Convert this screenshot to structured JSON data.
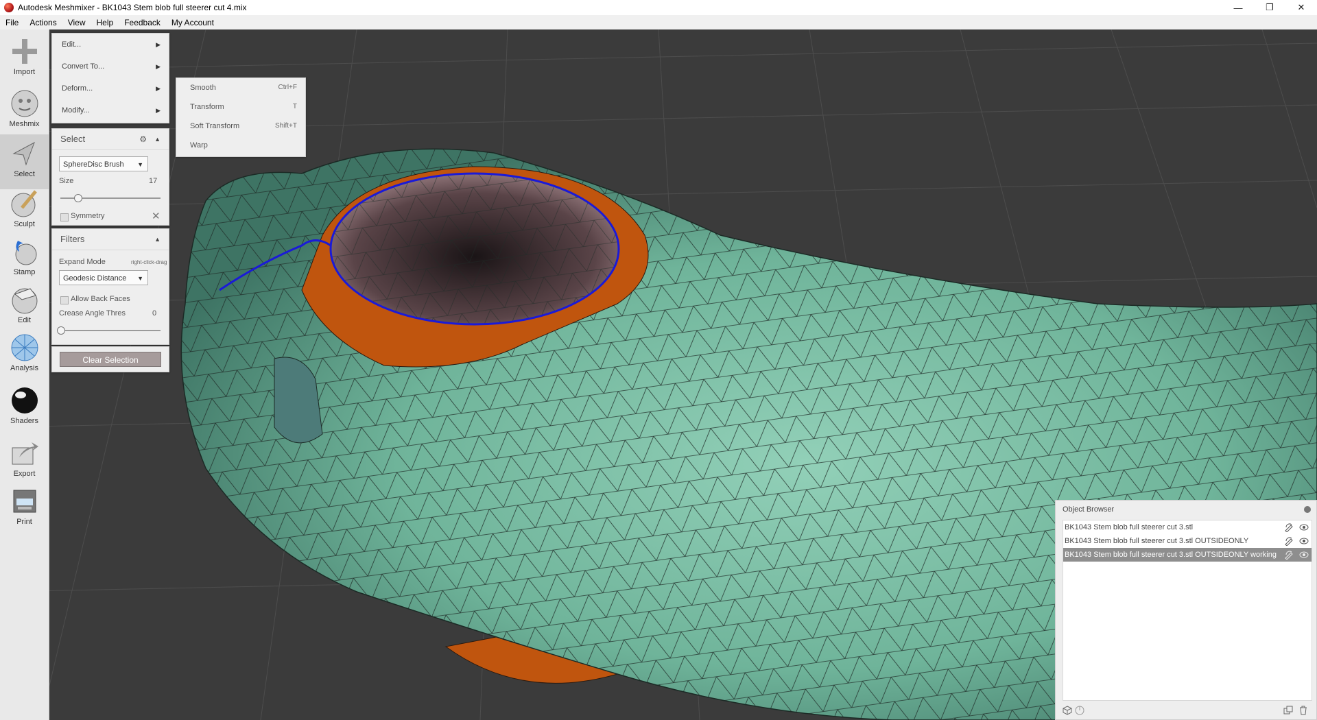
{
  "window": {
    "title": "Autodesk Meshmixer - BK1043 Stem blob full steerer cut 4.mix",
    "minimize": "—",
    "restore": "❐",
    "close": "✕"
  },
  "menubar": {
    "items": [
      "File",
      "Actions",
      "View",
      "Help",
      "Feedback",
      "My Account"
    ]
  },
  "toolbar": {
    "tools": [
      {
        "label": "Import",
        "icon": "plus-icon"
      },
      {
        "label": "Meshmix",
        "icon": "meshmix-sphere-icon"
      },
      {
        "label": "Select",
        "icon": "arrow-cursor-icon"
      },
      {
        "label": "Sculpt",
        "icon": "brush-sphere-icon"
      },
      {
        "label": "Stamp",
        "icon": "stamp-icon"
      },
      {
        "label": "Edit",
        "icon": "edit-sphere-icon"
      },
      {
        "label": "Analysis",
        "icon": "analysis-sphere-icon"
      },
      {
        "label": "Shaders",
        "icon": "shader-ball-icon"
      },
      {
        "label": "Export",
        "icon": "export-icon"
      },
      {
        "label": "Print",
        "icon": "printer-icon"
      }
    ]
  },
  "actions_menu": {
    "items": [
      {
        "label": "Edit..."
      },
      {
        "label": "Convert To..."
      },
      {
        "label": "Deform..."
      },
      {
        "label": "Modify..."
      }
    ]
  },
  "deform_submenu": {
    "items": [
      {
        "label": "Smooth",
        "shortcut": "Ctrl+F"
      },
      {
        "label": "Transform",
        "shortcut": "T"
      },
      {
        "label": "Soft Transform",
        "shortcut": "Shift+T"
      },
      {
        "label": "Warp",
        "shortcut": ""
      }
    ]
  },
  "select_panel": {
    "title": "Select",
    "brush": "SphereDisc Brush",
    "size_label": "Size",
    "size_value": "17",
    "size_fraction": 0.17,
    "symmetry_label": "Symmetry"
  },
  "filters_panel": {
    "title": "Filters",
    "expand_mode_label": "Expand Mode",
    "expand_hint": "right-click-drag",
    "expand_mode_value": "Geodesic Distance",
    "back_faces_label": "Allow Back Faces",
    "crease_label": "Crease Angle Thres",
    "crease_value": "0",
    "crease_fraction": 0.0
  },
  "clear_selection": "Clear Selection",
  "object_browser": {
    "title": "Object Browser",
    "objects": [
      {
        "name": "BK1043 Stem blob full steerer cut 3.stl",
        "selected": false
      },
      {
        "name": "BK1043 Stem blob full steerer cut 3.stl OUTSIDEONLY",
        "selected": false
      },
      {
        "name": "BK1043 Stem blob full steerer cut 3.stl OUTSIDEONLY working",
        "selected": true
      }
    ]
  },
  "colors": {
    "mesh_green": "#6fb49a",
    "selection_orange": "#c0550e",
    "boundary_blue": "#1a1ad8",
    "viewport_bg": "#3b3b3b"
  }
}
